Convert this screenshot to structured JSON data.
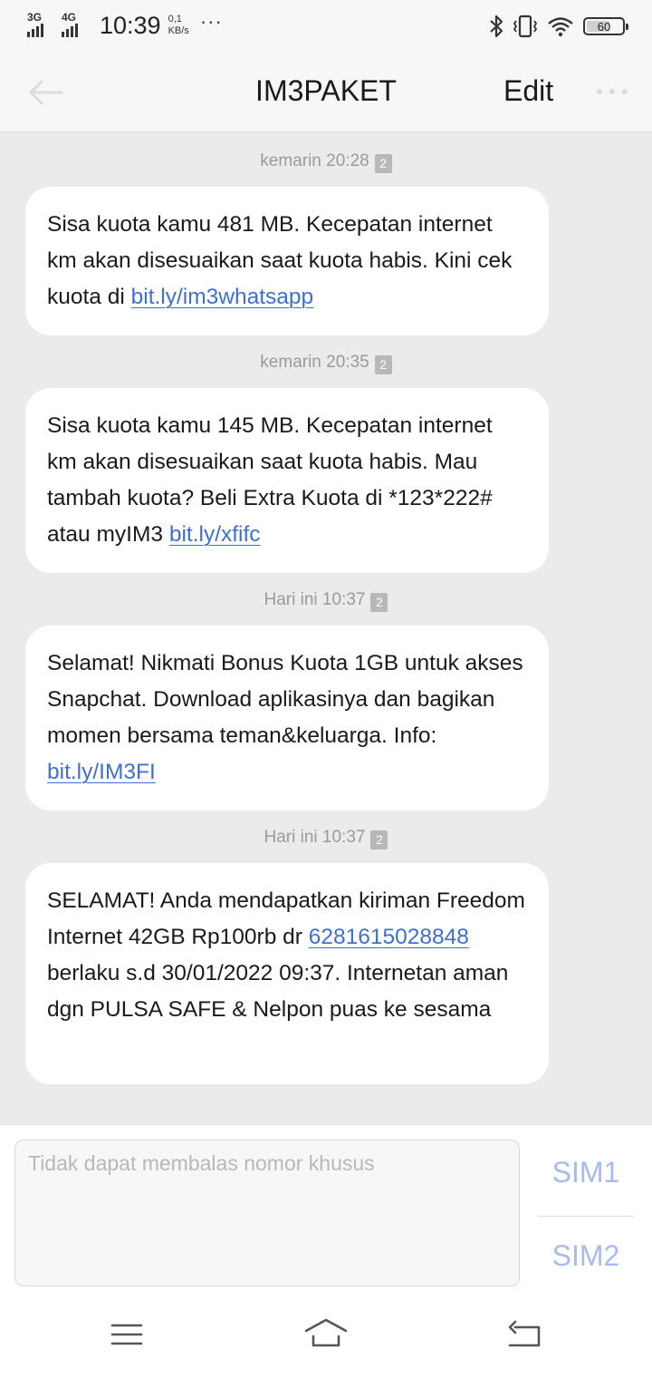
{
  "status": {
    "net1": "3G",
    "net2": "4G",
    "time": "10:39",
    "speed_value": "0,1",
    "speed_unit": "KB/s",
    "more": "···",
    "battery": "60"
  },
  "header": {
    "title": "IM3PAKET",
    "edit": "Edit"
  },
  "messages": [
    {
      "timestamp": "kemarin 20:28",
      "sim_badge": "2",
      "text": "Sisa kuota kamu 481 MB. Kecepatan internet km akan disesuaikan saat kuota habis. Kini cek kuota di ",
      "link": "bit.ly/im3whatsapp"
    },
    {
      "timestamp": "kemarin 20:35",
      "sim_badge": "2",
      "text": "Sisa kuota kamu 145 MB. Kecepatan internet km akan disesuaikan saat kuota habis. Mau tambah kuota? Beli Extra Kuota di *123*222# atau myIM3 ",
      "link": "bit.ly/xfifc"
    },
    {
      "timestamp": "Hari ini 10:37",
      "sim_badge": "2",
      "text": "Selamat! Nikmati Bonus Kuota 1GB untuk akses Snapchat. Download aplikasinya dan bagikan momen bersama teman&keluarga. Info: ",
      "link": "bit.ly/IM3FI"
    },
    {
      "timestamp": "Hari ini 10:37",
      "sim_badge": "2",
      "text_before": "SELAMAT! Anda mendapatkan kiriman Freedom Internet 42GB Rp100rb dr ",
      "link": "6281615028848",
      "text_after": " berlaku s.d 30/01/2022 09:37. Internetan aman dgn PULSA SAFE & Nelpon puas ke sesama"
    }
  ],
  "reply": {
    "placeholder": "Tidak dapat membalas nomor khusus",
    "sim1": "SIM1",
    "sim2": "SIM2"
  },
  "icons": {
    "back": "arrow-left-icon",
    "more": "more-horizontal-icon",
    "bluetooth": "bluetooth-icon",
    "vibrate": "vibrate-icon",
    "wifi": "wifi-icon",
    "menu": "menu-icon",
    "home": "home-icon",
    "return": "return-icon"
  }
}
